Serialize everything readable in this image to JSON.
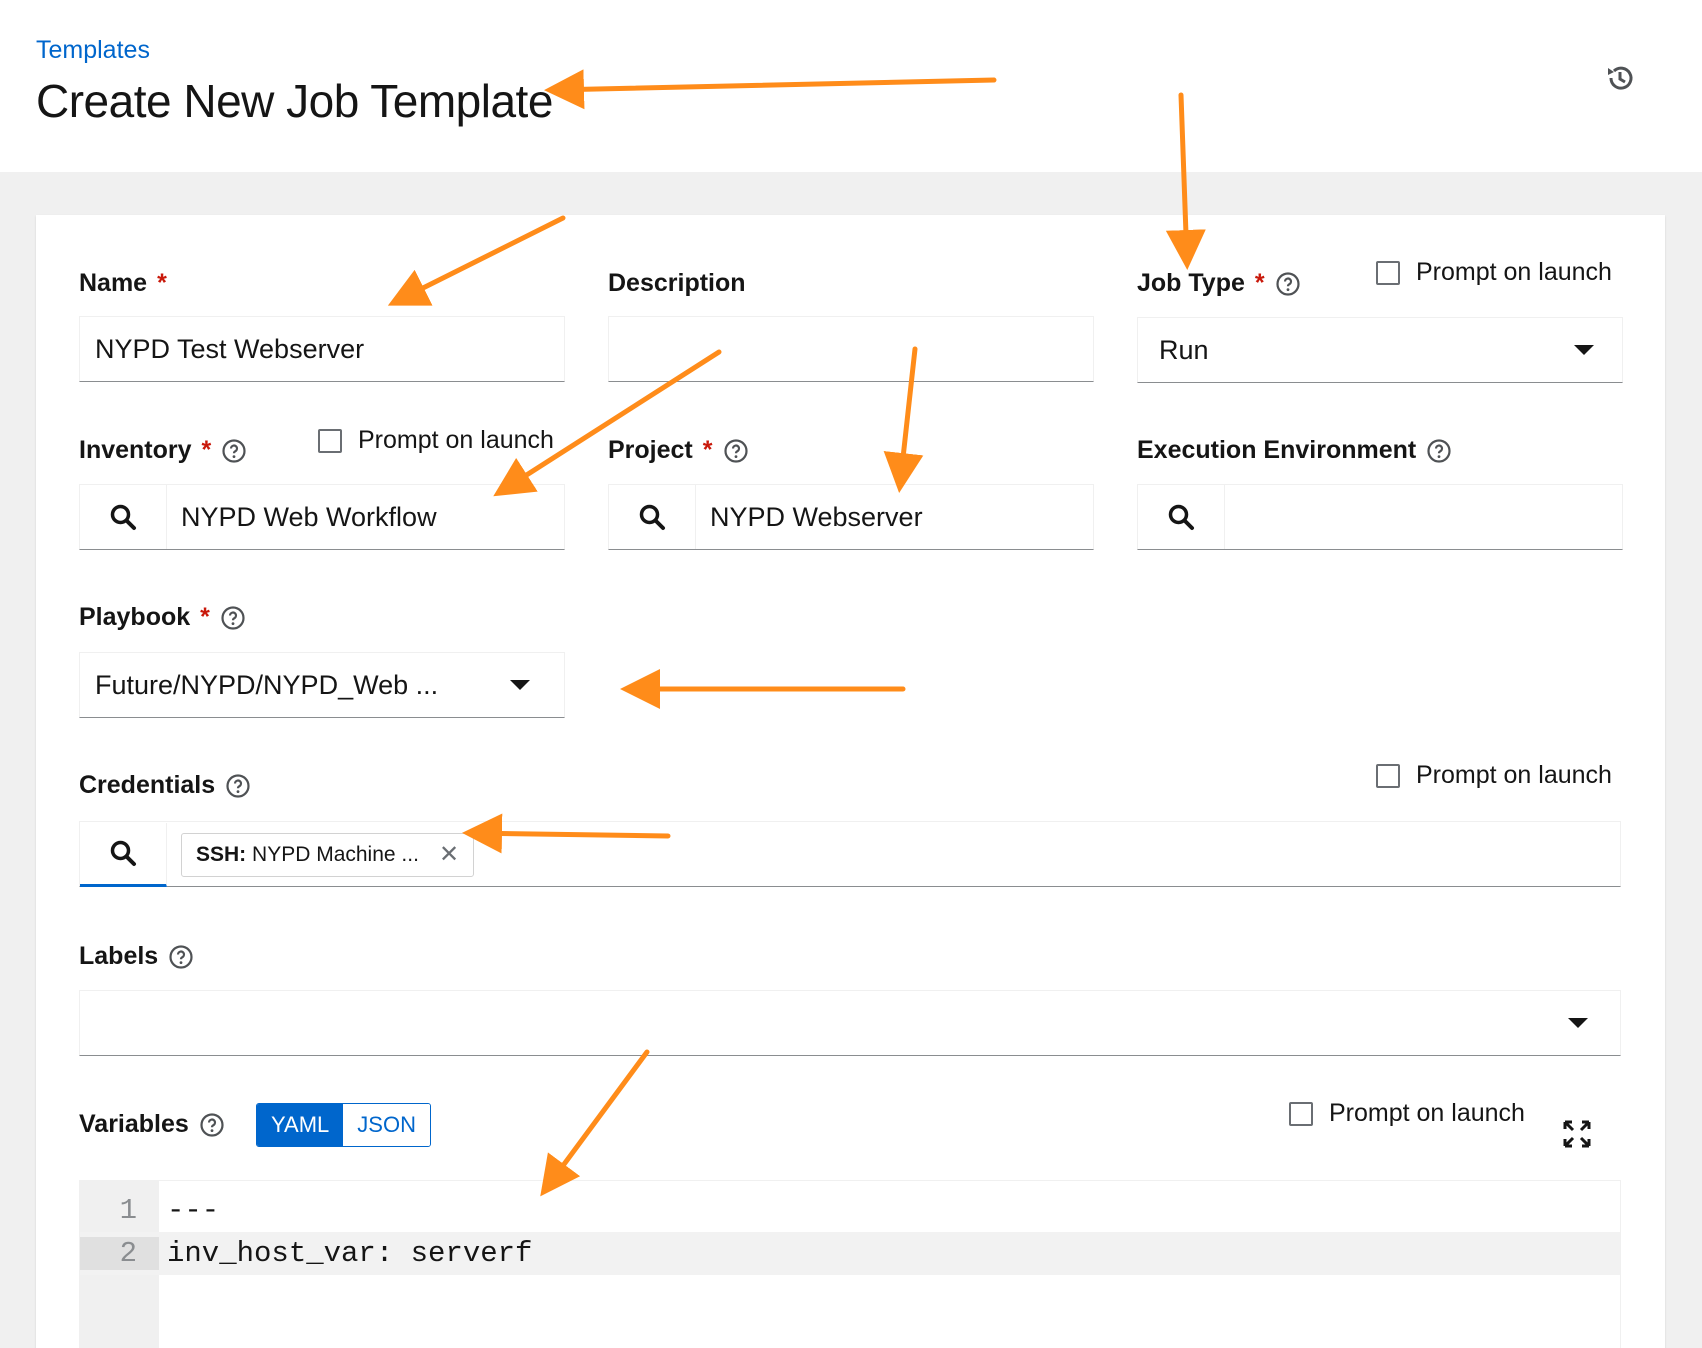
{
  "header": {
    "breadcrumb": "Templates",
    "title": "Create New Job Template"
  },
  "form": {
    "name": {
      "label": "Name",
      "value": "NYPD Test Webserver"
    },
    "description": {
      "label": "Description",
      "value": ""
    },
    "job_type": {
      "label": "Job Type",
      "value": "Run",
      "prompt_label": "Prompt on launch"
    },
    "inventory": {
      "label": "Inventory",
      "value": "NYPD Web Workflow",
      "prompt_label": "Prompt on launch"
    },
    "project": {
      "label": "Project",
      "value": "NYPD Webserver"
    },
    "execution_environment": {
      "label": "Execution Environment",
      "value": ""
    },
    "playbook": {
      "label": "Playbook",
      "value": "Future/NYPD/NYPD_Web ..."
    },
    "credentials": {
      "label": "Credentials",
      "prompt_label": "Prompt on launch",
      "chip": {
        "type": "SSH:",
        "name": "NYPD Machine ..."
      }
    },
    "labels": {
      "label": "Labels"
    },
    "variables": {
      "label": "Variables",
      "prompt_label": "Prompt on launch",
      "toggle": [
        "YAML",
        "JSON"
      ],
      "selected_format": "YAML",
      "lines": [
        {
          "num": "1",
          "code": "---"
        },
        {
          "num": "2",
          "code": "inv_host_var: serverf"
        }
      ]
    },
    "required_marker": "*"
  },
  "icons": {
    "history": "history-icon",
    "help": "help-circle-icon",
    "search": "search-icon",
    "caret": "caret-down-icon",
    "close": "close-icon",
    "expand": "expand-icon"
  },
  "colors": {
    "link": "#0066cc",
    "required": "#c9190b",
    "annotation_arrow": "#ff8c1a"
  }
}
